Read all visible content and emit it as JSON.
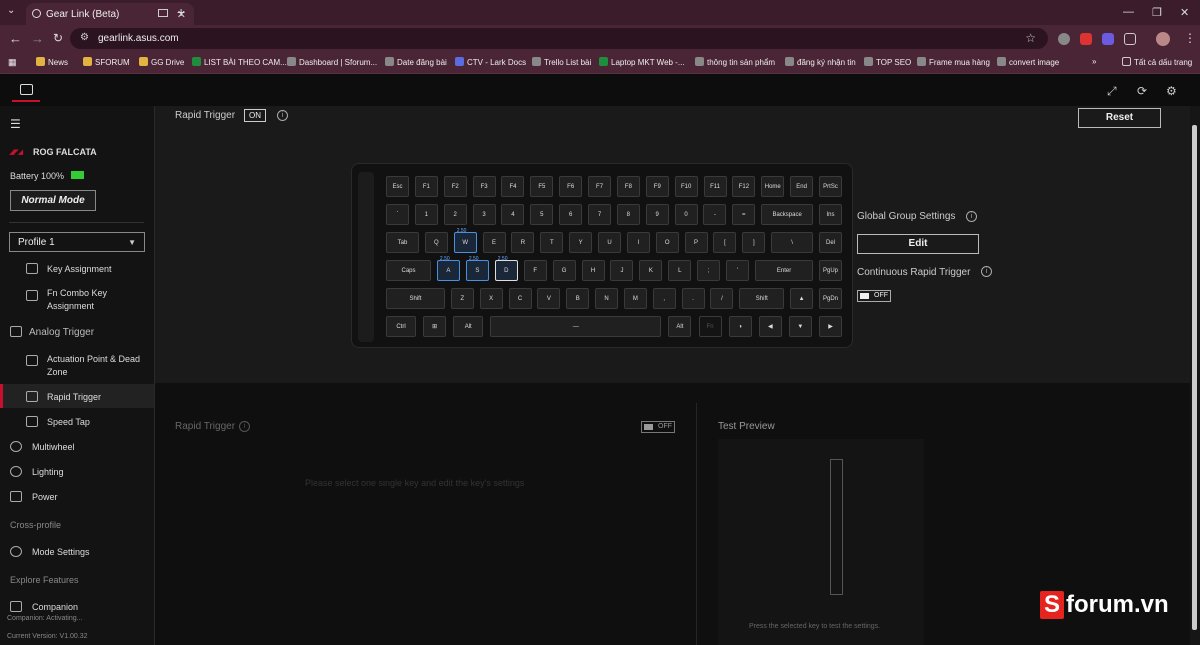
{
  "browser": {
    "tab_title": "Gear Link (Beta)",
    "url": "gearlink.asus.com",
    "bookmarks": [
      {
        "label": "News",
        "color": "#e3b341"
      },
      {
        "label": "SFORUM",
        "color": "#e3b341"
      },
      {
        "label": "GG Drive",
        "color": "#e3b341"
      },
      {
        "label": "LIST BÀI THEO CAM...",
        "color": "#1e8e3e"
      },
      {
        "label": "Dashboard | Sforum...",
        "color": "#888888"
      },
      {
        "label": "Date đăng bài",
        "color": "#888888"
      },
      {
        "label": "CTV - Lark Docs",
        "color": "#5b6be0"
      },
      {
        "label": "Trello List bài",
        "color": "#888888"
      },
      {
        "label": "Laptop MKT Web -...",
        "color": "#1e8e3e"
      },
      {
        "label": "thông tin sản phẩm",
        "color": "#888888"
      },
      {
        "label": "đăng ký nhận tin",
        "color": "#888888"
      },
      {
        "label": "TOP SEO",
        "color": "#888888"
      },
      {
        "label": "Frame mua hàng",
        "color": "#888888"
      },
      {
        "label": "convert image",
        "color": "#888888"
      }
    ],
    "all_bookmarks": "Tất cả dấu trang"
  },
  "sidebar": {
    "device_name": "ROG FALCATA",
    "battery": "Battery 100%",
    "mode": "Normal Mode",
    "profile": "Profile 1",
    "items": {
      "key_assignment": "Key Assignment",
      "fn_combo": "Fn Combo Key Assignment",
      "analog_trigger": "Analog Trigger",
      "actuation": "Actuation Point & Dead Zone",
      "rapid_trigger": "Rapid Trigger",
      "speed_tap": "Speed Tap",
      "multiwheel": "Multiwheel",
      "lighting": "Lighting",
      "power": "Power",
      "cross_profile": "Cross-profile",
      "mode_settings": "Mode Settings",
      "explore": "Explore Features",
      "companion": "Companion"
    },
    "companion_status": "Companion: Activating...",
    "version": "Current Version: V1.00.32"
  },
  "main": {
    "rapid_trigger_label": "Rapid Trigger",
    "rapid_trigger_state": "ON",
    "reset": "Reset",
    "global_group": "Global Group Settings",
    "edit": "Edit",
    "continuous_rt": "Continuous Rapid Trigger",
    "off": "OFF",
    "lower_rt_label": "Rapid Trigger",
    "placeholder": "Please select one single key and edit the key's settings",
    "test_preview": "Test Preview",
    "test_hint": "Press the selected key to test the settings."
  },
  "keyboard": {
    "value": "2.50",
    "rows": [
      [
        "Esc",
        "F1",
        "F2",
        "F3",
        "F4",
        "F5",
        "F6",
        "F7",
        "F8",
        "F9",
        "F10",
        "F11",
        "F12",
        "Home",
        "End",
        "PrtSc"
      ],
      [
        "`",
        "1",
        "2",
        "3",
        "4",
        "5",
        "6",
        "7",
        "8",
        "9",
        "0",
        "-",
        "=",
        "Backspace",
        "Ins"
      ],
      [
        "Tab",
        "Q",
        "W",
        "E",
        "R",
        "T",
        "Y",
        "U",
        "I",
        "O",
        "P",
        "[",
        "]",
        "\\",
        "Del"
      ],
      [
        "Caps",
        "A",
        "S",
        "D",
        "F",
        "G",
        "H",
        "J",
        "K",
        "L",
        ";",
        "'",
        "Enter",
        "PgUp"
      ],
      [
        "Shift",
        "Z",
        "X",
        "C",
        "V",
        "B",
        "N",
        "M",
        ",",
        ".",
        "/",
        "Shift",
        "▲",
        "PgDn"
      ],
      [
        "Ctrl",
        "⊞",
        "Alt",
        "—",
        "Alt",
        "Fn",
        "◑",
        "◀",
        "▼",
        "▶"
      ]
    ]
  },
  "watermark": {
    "s": "S",
    "rest": "forum.vn"
  }
}
